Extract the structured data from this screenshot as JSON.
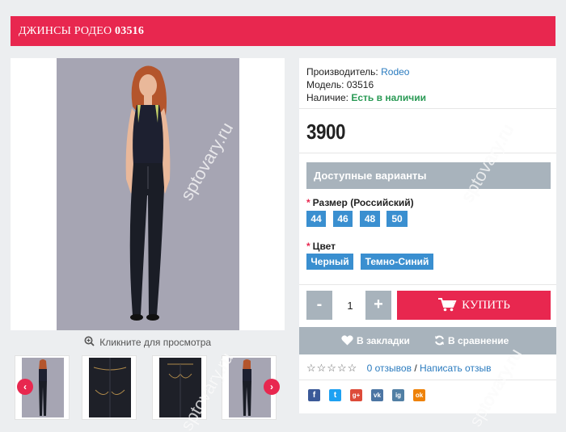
{
  "product": {
    "title_prefix": "ДЖИНСЫ РОДЕО",
    "title_code": "03516"
  },
  "gallery": {
    "zoom_caption": "Кликните для просмотра",
    "prev_arrow": "‹",
    "next_arrow": "›"
  },
  "info": {
    "manufacturer_label": "Производитель:",
    "manufacturer_value": "Rodeo",
    "model_label": "Модель:",
    "model_value": "03516",
    "availability_label": "Наличие:",
    "availability_value": "Есть в наличии",
    "price": "3900"
  },
  "variants": {
    "heading": "Доступные варианты",
    "required_mark": "*",
    "size_label": "Размер (Российский)",
    "sizes": [
      "44",
      "46",
      "48",
      "50"
    ],
    "color_label": "Цвет",
    "colors": [
      "Черный",
      "Темно-Синий"
    ]
  },
  "purchase": {
    "minus": "-",
    "quantity": "1",
    "plus": "+",
    "buy_label": "КУПИТЬ"
  },
  "actions": {
    "bookmarks": "В закладки",
    "compare": "В сравнение"
  },
  "reviews": {
    "stars": "☆☆☆☆☆",
    "count_link": "0 отзывов",
    "separator": "/",
    "write_link": "Написать отзыв"
  },
  "social": [
    "f",
    "t",
    "g+",
    "vk",
    "ig",
    "ok"
  ],
  "watermark": "sptovary.ru",
  "colors": {
    "accent": "#e8274f",
    "variant_chip": "#3a8fd0",
    "gray_bar": "#a8b3bc",
    "availability": "#2a9a55",
    "link": "#2a7bbf"
  }
}
